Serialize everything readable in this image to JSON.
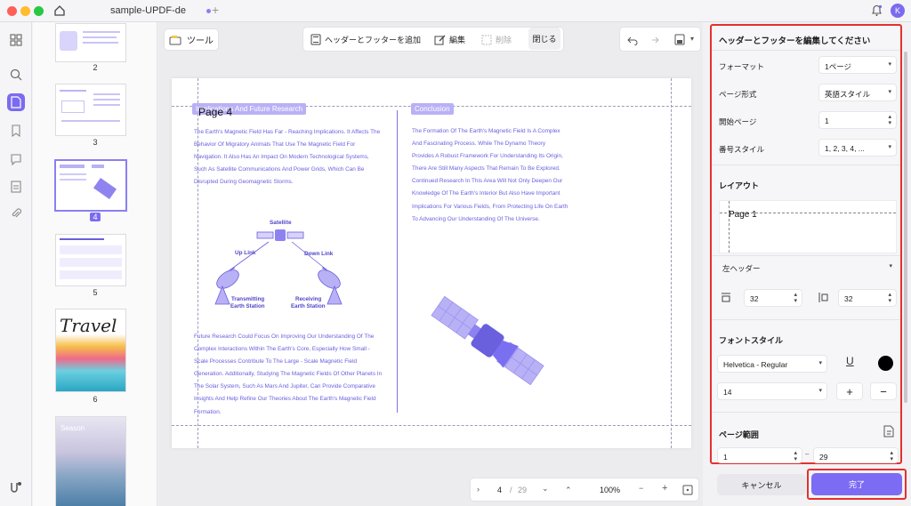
{
  "app": {
    "tab_title": "sample-UPDF-de",
    "avatar_letter": "K",
    "accent": "#7a6bf0"
  },
  "toolbar": {
    "tool_label": "ツール",
    "add_header_footer": "ヘッダーとフッターを追加",
    "edit": "編集",
    "delete": "削除",
    "close": "閉じる"
  },
  "thumbnails": [
    {
      "page": "2"
    },
    {
      "page": "3"
    },
    {
      "page": "4",
      "selected": true
    },
    {
      "page": "5"
    },
    {
      "page": "6"
    }
  ],
  "thumb_travel_title": "Travel",
  "thumb_season_title": "Season",
  "document": {
    "page_header_text": "Page 4",
    "left_heading": "Implications And Future Research",
    "left_para1": "The Earth's Magnetic Field Has Far - Reaching Implications. It Affects The Behavior Of Migratory Animals That Use The Magnetic Field For Navigation. It Also Has An Impact On Modern Technological Systems, Such As Satellite Communications And Power Grids, Which Can Be Disrupted During Geomagnetic Storms.",
    "diagram_satellite": "Satellite",
    "diagram_uplink": "Up Link",
    "diagram_downlink": "Down Link",
    "diagram_tx1": "Transmitting",
    "diagram_tx2": "Earth Station",
    "diagram_rx1": "Receiving",
    "diagram_rx2": "Earth Station",
    "left_para2": "Future Research Could Focus On Improving Our Understanding Of The Complex Interactions Within The Earth's Core, Especially How Small - Scale Processes Contribute To The Large - Scale Magnetic Field Generation. Additionally, Studying The Magnetic Fields Of Other Planets In The Solar System, Such As Mars And Jupiter, Can Provide Comparative Insights And Help Refine Our Theories About The Earth's Magnetic Field Formation.",
    "right_heading": "Conclusion",
    "right_para": "The Formation Of The Earth's Magnetic Field Is A Complex And Fascinating Process. While The Dynamo Theory Provides A Robust Framework For Understanding Its Origin, There Are Still Many Aspects That Remain To Be Explored. Continued Research In This Area Will Not Only Deepen Our Knowledge Of The Earth's Interior But Also Have Important Implications For Various Fields, From Protecting Life On Earth To Advancing Our Understanding Of The Universe."
  },
  "pager": {
    "current": "4",
    "separator": "/",
    "total": "29",
    "zoom": "100%"
  },
  "panel": {
    "title": "ヘッダーとフッターを編集してください",
    "format_label": "フォーマット",
    "format_value": "1ページ",
    "page_style_label": "ページ形式",
    "page_style_value": "英語スタイル",
    "start_page_label": "開始ページ",
    "start_page_value": "1",
    "number_style_label": "番号スタイル",
    "number_style_value": "1, 2, 3, 4, ...",
    "layout_title": "レイアウト",
    "layout_preview": "Page 1",
    "position_value": "左ヘッダー",
    "margin_top": "32",
    "margin_side": "32",
    "font_title": "フォントスタイル",
    "font_value": "Helvetica - Regular",
    "underline_glyph": "U",
    "font_color": "#000000",
    "font_size": "14",
    "range_title": "ページ範囲",
    "range_from": "1",
    "range_dash": "–",
    "range_to": "29",
    "cancel": "キャンセル",
    "done": "完了"
  }
}
